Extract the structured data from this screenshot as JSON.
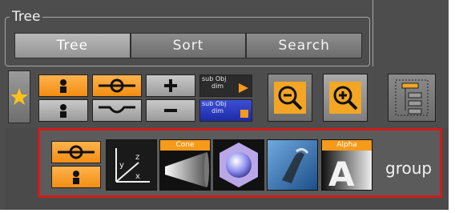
{
  "tree_group": {
    "title": "Tree",
    "tabs": [
      {
        "label": "Tree",
        "active": true
      },
      {
        "label": "Sort",
        "active": false
      },
      {
        "label": "Search",
        "active": false
      }
    ]
  },
  "toolbar": {
    "star_icon": "star-icon",
    "sub_object_1": {
      "line1": "sub Obj",
      "line2": "dim"
    },
    "sub_object_2": {
      "line1": "sub Obj",
      "line2": "dim"
    }
  },
  "items": [
    {
      "name": "axis-item",
      "label": ""
    },
    {
      "name": "cone-item",
      "label": "Cone"
    },
    {
      "name": "sphere-item",
      "label": ""
    },
    {
      "name": "image-item",
      "label": ""
    },
    {
      "name": "alpha-item",
      "label": "Alpha"
    }
  ],
  "group_label": "group",
  "colors": {
    "panel": "#4d4d4d",
    "accent_orange": "#f59a1a",
    "highlight_red": "#d01b1b",
    "sub_object_blue": "#1b2ba8"
  }
}
